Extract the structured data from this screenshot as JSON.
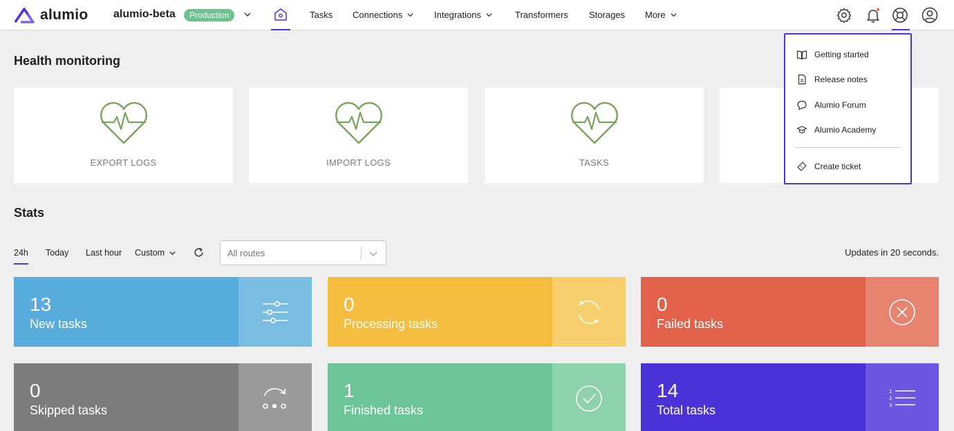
{
  "brand": {
    "name": "alumio",
    "color": "#4a36d6"
  },
  "environment": {
    "name": "alumio-beta",
    "badge": "Production"
  },
  "nav": {
    "items": [
      {
        "label": "Tasks"
      },
      {
        "label": "Connections"
      },
      {
        "label": "Integrations"
      },
      {
        "label": "Transformers"
      },
      {
        "label": "Storages"
      },
      {
        "label": "More"
      }
    ]
  },
  "toolbar": {
    "icons": [
      "gear-icon",
      "bell-icon",
      "support-icon",
      "user-icon"
    ]
  },
  "health": {
    "title": "Health monitoring",
    "cards": [
      {
        "label": "EXPORT LOGS"
      },
      {
        "label": "IMPORT LOGS"
      },
      {
        "label": "TASKS"
      },
      {
        "label": ""
      }
    ],
    "icon_color": "#7aa35a"
  },
  "support_menu": {
    "items": [
      {
        "label": "Getting started",
        "icon": "book-icon"
      },
      {
        "label": "Release notes",
        "icon": "document-icon"
      },
      {
        "label": "Alumio Forum",
        "icon": "chat-icon"
      },
      {
        "label": "Alumio Academy",
        "icon": "graduation-icon"
      }
    ],
    "footer": {
      "label": "Create ticket",
      "icon": "ticket-icon"
    }
  },
  "stats": {
    "title": "Stats",
    "filters": {
      "h24": "24h",
      "today": "Today",
      "last_hour": "Last hour",
      "custom": "Custom"
    },
    "routes_placeholder": "All routes",
    "updates_text": "Updates in 20 seconds.",
    "cards": [
      {
        "value": "13",
        "label": "New tasks",
        "color": "#58acdc",
        "side": "#79bde3"
      },
      {
        "value": "0",
        "label": "Processing tasks",
        "color": "#f4bd3f",
        "side": "#f7cf6e"
      },
      {
        "value": "0",
        "label": "Failed tasks",
        "color": "#e2614a",
        "side": "#e8836f"
      },
      {
        "value": "0",
        "label": "Skipped tasks",
        "color": "#7c7c7c",
        "side": "#9a9a9a"
      },
      {
        "value": "1",
        "label": "Finished tasks",
        "color": "#6cc596",
        "side": "#8ed2ac"
      },
      {
        "value": "14",
        "label": "Total tasks",
        "color": "#4a33d6",
        "side": "#6c57e2"
      }
    ]
  }
}
